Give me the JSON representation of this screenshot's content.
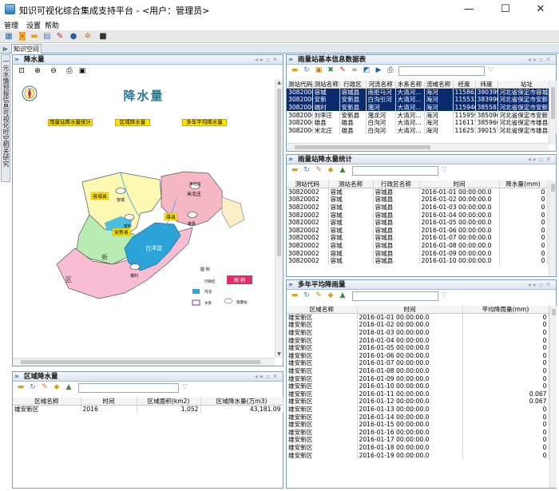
{
  "window": {
    "title": "知识可视化综合集成支持平台 - <用户：管理员>",
    "minimize": "—",
    "maximize": "☐",
    "close": "✕"
  },
  "menu": [
    "管理",
    "设置",
    "帮助"
  ],
  "toolbar_icons": [
    "grid-icon",
    "rss-icon",
    "folder-icon",
    "document-icon",
    "tools-icon",
    "user-icon",
    "gear-icon",
    "video-icon"
  ],
  "tabs": {
    "active": "知识空间",
    "pin": "⊳"
  },
  "side_tab": "一元水情预报信息可视化时空相关研究",
  "map_panel": {
    "title": "降水量",
    "map_title": "降水量",
    "buttons": [
      "雨量站降水量统计",
      "区域降水量",
      "多年平均降水量"
    ],
    "regions": [
      "容城县",
      "安新县",
      "雄县",
      "白洋淀",
      "米北庄",
      "新",
      "区"
    ],
    "stations": [
      "容城",
      "安新",
      "雄县",
      "米北庄",
      "端村"
    ],
    "legend": {
      "title": "图 例",
      "badge": "图 例",
      "items": [
        "河流",
        "水系",
        "行政区",
        "雨量站"
      ]
    }
  },
  "region_panel": {
    "title": "区域降水量",
    "columns": [
      "区域名称",
      "时间",
      "区域面积(km2)",
      "区域降水量(万m3)"
    ],
    "rows": [
      [
        "雄安新区",
        "2016",
        "1,052",
        "43,181.09"
      ]
    ]
  },
  "station_info_panel": {
    "title": "雨量站基本信息数据表",
    "columns": [
      "测站代码",
      "测站名称",
      "行政区",
      "河流名称",
      "水系名称",
      "流域名称",
      "经度",
      "纬度",
      "站址"
    ],
    "rows": [
      [
        "30820002",
        "容城",
        "容城县",
        "南拒马河",
        "大清河...",
        "海河",
        "1158624",
        "390399",
        "河北省保定市容城县"
      ],
      [
        "30820001",
        "安新",
        "安新县",
        "白沟引河",
        "大清河...",
        "海河",
        "1155337",
        "383996",
        "河北省保定市安新县"
      ],
      [
        "30820003",
        "端村",
        "安新县",
        "潴河",
        "大清河...",
        "海河",
        "1159469",
        "385581",
        "河北省保定市安新县"
      ],
      [
        "30820004",
        "刘李庄",
        "安新县",
        "潴龙河",
        "大清河...",
        "海河",
        "115959",
        "385096",
        "河北省保定市安新县"
      ],
      [
        "30820005",
        "雄县",
        "雄县",
        "白沟河",
        "大清河...",
        "海河",
        "1161171",
        "385966",
        "河北省保定市雄县"
      ],
      [
        "30820006",
        "米北庄",
        "雄县",
        "白沟河",
        "大清河...",
        "海河",
        "1162511",
        "390157",
        "河北省保定市雄县"
      ]
    ],
    "selected_rows": 3
  },
  "station_rain_panel": {
    "title": "雨量站降水量统计",
    "columns": [
      "测站代码",
      "测站名称",
      "行政区名称",
      "时间",
      "降水量(mm)"
    ],
    "rows": [
      [
        "30820002",
        "容城",
        "容城县",
        "2016-01-01 00:00:00.0",
        "0"
      ],
      [
        "30820002",
        "容城",
        "容城县",
        "2016-01-02 00:00:00.0",
        "0"
      ],
      [
        "30820002",
        "容城",
        "容城县",
        "2016-01-03 00:00:00.0",
        "0"
      ],
      [
        "30820002",
        "容城",
        "容城县",
        "2016-01-04 00:00:00.0",
        "0"
      ],
      [
        "30820002",
        "容城",
        "容城县",
        "2016-01-05 00:00:00.0",
        "0"
      ],
      [
        "30820002",
        "容城",
        "容城县",
        "2016-01-06 00:00:00.0",
        "0"
      ],
      [
        "30820002",
        "容城",
        "容城县",
        "2016-01-07 00:00:00.0",
        "0"
      ],
      [
        "30820002",
        "容城",
        "容城县",
        "2016-01-08 00:00:00.0",
        "0"
      ],
      [
        "30820002",
        "容城",
        "容城县",
        "2016-01-09 00:00:00.0",
        "0"
      ],
      [
        "30820002",
        "容城",
        "容城县",
        "2016-01-10 00:00:00.0",
        "0"
      ]
    ]
  },
  "avg_rain_panel": {
    "title": "多年平均降雨量",
    "columns": [
      "区域名称",
      "时间",
      "平均降雨量(mm)"
    ],
    "rows": [
      [
        "雄安新区",
        "2016-01-01 00:00:00.0",
        "0"
      ],
      [
        "雄安新区",
        "2016-01-02 00:00:00.0",
        "0"
      ],
      [
        "雄安新区",
        "2016-01-03 00:00:00.0",
        "0"
      ],
      [
        "雄安新区",
        "2016-01-04 00:00:00.0",
        "0"
      ],
      [
        "雄安新区",
        "2016-01-05 00:00:00.0",
        "0"
      ],
      [
        "雄安新区",
        "2016-01-06 00:00:00.0",
        "0"
      ],
      [
        "雄安新区",
        "2016-01-07 00:00:00.0",
        "0"
      ],
      [
        "雄安新区",
        "2016-01-08 00:00:00.0",
        "0"
      ],
      [
        "雄安新区",
        "2016-01-09 00:00:00.0",
        "0"
      ],
      [
        "雄安新区",
        "2016-01-10 00:00:00.0",
        "0"
      ],
      [
        "雄安新区",
        "2016-01-11 00:00:00.0",
        "0.067"
      ],
      [
        "雄安新区",
        "2016-01-12 00:00:00.0",
        "0.067"
      ],
      [
        "雄安新区",
        "2016-01-13 00:00:00.0",
        "0"
      ],
      [
        "雄安新区",
        "2016-01-14 00:00:00.0",
        "0"
      ],
      [
        "雄安新区",
        "2016-01-15 00:00:00.0",
        "0"
      ],
      [
        "雄安新区",
        "2016-01-16 00:00:00.0",
        "0"
      ],
      [
        "雄安新区",
        "2016-01-17 00:00:00.0",
        "0"
      ],
      [
        "雄安新区",
        "2016-01-18 00:00:00.0",
        "0"
      ],
      [
        "雄安新区",
        "2016-01-19 00:00:00.0",
        "0"
      ]
    ]
  },
  "colors": {
    "selected_row": "#0a2a6e",
    "panel_border": "#7f9db9",
    "button_yellow": "#ffe400"
  }
}
